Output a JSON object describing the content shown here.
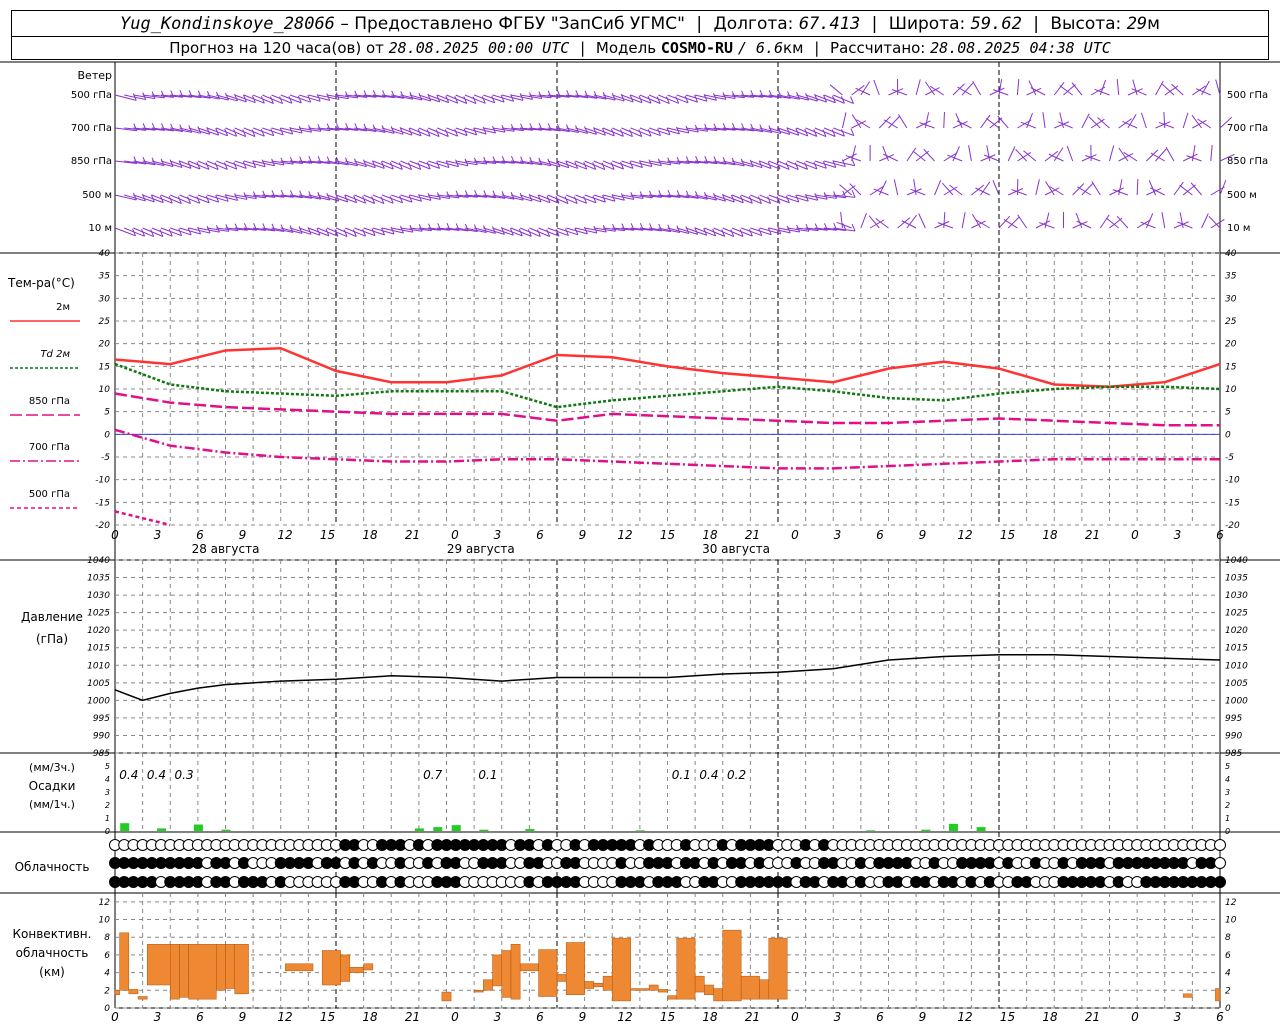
{
  "header": {
    "station": "Yug_Kondinskoye_28066",
    "provider": "– Предоставлено ФГБУ \"ЗапСиб УГМС\"",
    "lon_label": "Долгота:",
    "lon_value": "67.413",
    "lat_label": "Широта:",
    "lat_value": "59.62",
    "alt_label": "Высота:",
    "alt_value": "29",
    "alt_unit": "м",
    "forecast_label": "Прогноз на 120 часа(ов) от",
    "forecast_start": "28.08.2025 00:00 UTC",
    "model_label": "Модель",
    "model_name": "COSMO-RU",
    "model_res": "/ 6.6",
    "model_res_unit": "км",
    "calc_label": "Рассчитано:",
    "calc_time": "28.08.2025 04:38 UTC"
  },
  "chart_data": [
    {
      "type": "wind-barbs",
      "label": "Ветер",
      "levels": [
        "500 гПа",
        "700 гПа",
        "850 гПа",
        "500 м",
        "10 м"
      ]
    },
    {
      "type": "line",
      "title_line1": "Тем-ра(°C)",
      "legend": [
        {
          "name": "2м",
          "color": "#ff3333",
          "style": "solid"
        },
        {
          "name": "Td  2м",
          "color": "#117711",
          "style": "dotted"
        },
        {
          "name": "850 гПа",
          "color": "#e0108a",
          "style": "dash"
        },
        {
          "name": "700 гПа",
          "color": "#e0108a",
          "style": "dashdot"
        },
        {
          "name": "500 гПа",
          "color": "#e0108a",
          "style": "shortdash"
        }
      ],
      "ylim": [
        -20,
        40
      ],
      "yticks": [
        "40",
        "35",
        "30",
        "25",
        "20",
        "15",
        "10",
        "5",
        "0",
        "-5",
        "-10",
        "-15",
        "-20"
      ],
      "x_hours": [
        0,
        6,
        12,
        18,
        24,
        30,
        36,
        42,
        48,
        54,
        60,
        66,
        72,
        78,
        84,
        90,
        96,
        102,
        108,
        114,
        120
      ],
      "series": [
        {
          "name": "2м",
          "values": [
            16.5,
            15.5,
            18.5,
            19,
            14,
            11.5,
            11.5,
            13,
            17.5,
            17,
            15,
            13.5,
            12.5,
            11.5,
            14.5,
            16,
            14.5,
            11,
            10.5,
            11.5,
            15.5
          ]
        },
        {
          "name": "Td  2м",
          "values": [
            15.5,
            11,
            9.5,
            9,
            8.5,
            9.5,
            9.5,
            9.5,
            6,
            7.5,
            8.5,
            9.5,
            10.5,
            9.5,
            8,
            7.5,
            9,
            10,
            10.5,
            10.5,
            10
          ]
        },
        {
          "name": "850 гПа",
          "values": [
            9,
            7,
            6,
            5.5,
            5,
            4.5,
            4.5,
            4.5,
            3,
            4.5,
            4,
            3.5,
            3,
            2.5,
            2.5,
            3,
            3.5,
            3,
            2.5,
            2,
            2
          ]
        },
        {
          "name": "700 гПа",
          "values": [
            1,
            -2.5,
            -4,
            -5,
            -5.5,
            -6,
            -6,
            -5.5,
            -5.5,
            -6,
            -6.5,
            -7,
            -7.5,
            -7.5,
            -7,
            -6.5,
            -6,
            -5.5,
            -5.5,
            -5.5,
            -5.5
          ]
        },
        {
          "name": "500 гПа",
          "values": [
            -17,
            -20
          ]
        }
      ],
      "date_labels": [
        "28 августа",
        "29 августа",
        "30 августа"
      ],
      "tick_labels": [
        "0",
        "3",
        "6",
        "9",
        "12",
        "15",
        "18",
        "21",
        "0",
        "3",
        "6",
        "9",
        "12",
        "15",
        "18",
        "21",
        "0",
        "3",
        "6",
        "9",
        "12",
        "15",
        "18",
        "21",
        "0",
        "3",
        "6"
      ]
    },
    {
      "type": "line",
      "title_line1": "Давление",
      "title_line2": "(гПа)",
      "ylim": [
        985,
        1040
      ],
      "yticks": [
        "1040",
        "1035",
        "1030",
        "1025",
        "1020",
        "1015",
        "1010",
        "1005",
        "1000",
        "995",
        "990",
        "985"
      ],
      "x_hours": [
        0,
        3,
        6,
        9,
        12,
        18,
        24,
        30,
        36,
        42,
        48,
        54,
        60,
        66,
        72,
        78,
        84,
        90,
        96,
        102,
        108,
        114,
        120
      ],
      "values": [
        1003,
        1000,
        1002,
        1003.5,
        1004.5,
        1005.5,
        1006,
        1007,
        1006.5,
        1005.5,
        1006.5,
        1006.5,
        1006.5,
        1007.5,
        1008,
        1009,
        1011.5,
        1012.5,
        1013,
        1013,
        1012.5,
        1012,
        1011.5
      ]
    },
    {
      "type": "bar",
      "title_line1": "(мм/3ч.)",
      "title_line2": "Осадки",
      "title_line3": "(мм/1ч.)",
      "ylim": [
        0,
        5
      ],
      "yticks": [
        "5",
        "4",
        "3",
        "2",
        "1",
        "0"
      ],
      "color": "#22cc22",
      "x_hours": [
        1,
        5,
        9,
        12,
        33,
        35,
        37,
        40,
        45,
        57,
        82,
        88,
        91,
        94
      ],
      "values": [
        0.6,
        0.2,
        0.5,
        0.1,
        0.2,
        0.3,
        0.45,
        0.1,
        0.15,
        0.05,
        0.05,
        0.1,
        0.55,
        0.3
      ],
      "totals": [
        {
          "hour": 1.5,
          "text": "0.4"
        },
        {
          "hour": 4.5,
          "text": "0.4"
        },
        {
          "hour": 7.5,
          "text": "0.3"
        },
        {
          "hour": 34.5,
          "text": "0.7"
        },
        {
          "hour": 40.5,
          "text": "0.1"
        },
        {
          "hour": 61.5,
          "text": "0.1"
        },
        {
          "hour": 64.5,
          "text": "0.4"
        },
        {
          "hour": 67.5,
          "text": "0.2"
        }
      ]
    },
    {
      "type": "table",
      "label": "Облачность",
      "rows": 3
    },
    {
      "type": "bar",
      "title_line1": "Конвективн.",
      "title_line2": "облачность",
      "title_line3": "(км)",
      "ylim": [
        0,
        13
      ],
      "yticks": [
        "12",
        "10",
        "8",
        "6",
        "4",
        "2",
        "0"
      ],
      "color": "#ee8833",
      "blocks": [
        {
          "h0": 0,
          "h1": 0.5,
          "b": 1.5,
          "t": 2
        },
        {
          "h0": 0.5,
          "h1": 1.5,
          "b": 2,
          "t": 8.5
        },
        {
          "h0": 1.5,
          "h1": 2.5,
          "b": 1.6,
          "t": 2.1
        },
        {
          "h0": 2.5,
          "h1": 3.5,
          "b": 1,
          "t": 1.3
        },
        {
          "h0": 3.5,
          "h1": 6,
          "b": 2.6,
          "t": 7.2
        },
        {
          "h0": 6,
          "h1": 7,
          "b": 1,
          "t": 7.2
        },
        {
          "h0": 7,
          "h1": 8,
          "b": 1.2,
          "t": 7.2
        },
        {
          "h0": 8,
          "h1": 11,
          "b": 1,
          "t": 7.2
        },
        {
          "h0": 11,
          "h1": 12,
          "b": 2,
          "t": 7.2
        },
        {
          "h0": 12,
          "h1": 13,
          "b": 2.2,
          "t": 7.2
        },
        {
          "h0": 13,
          "h1": 14.5,
          "b": 1.6,
          "t": 7.2
        },
        {
          "h0": 18.5,
          "h1": 21.5,
          "b": 4.2,
          "t": 5
        },
        {
          "h0": 22.5,
          "h1": 24.5,
          "b": 2.6,
          "t": 6.5
        },
        {
          "h0": 24.5,
          "h1": 25.5,
          "b": 3,
          "t": 6
        },
        {
          "h0": 25.5,
          "h1": 27,
          "b": 4,
          "t": 4.6
        },
        {
          "h0": 27,
          "h1": 28,
          "b": 4.3,
          "t": 5
        },
        {
          "h0": 35.5,
          "h1": 36.5,
          "b": 0.8,
          "t": 1.8
        },
        {
          "h0": 39,
          "h1": 40,
          "b": 1.8,
          "t": 2
        },
        {
          "h0": 40,
          "h1": 41,
          "b": 2,
          "t": 3.2
        },
        {
          "h0": 41,
          "h1": 42,
          "b": 2.5,
          "t": 6
        },
        {
          "h0": 42,
          "h1": 43,
          "b": 1.2,
          "t": 6.5
        },
        {
          "h0": 43,
          "h1": 44,
          "b": 1,
          "t": 7.2
        },
        {
          "h0": 44,
          "h1": 46,
          "b": 4.2,
          "t": 5
        },
        {
          "h0": 46,
          "h1": 48,
          "b": 1.3,
          "t": 6.6
        },
        {
          "h0": 48,
          "h1": 49,
          "b": 3,
          "t": 3.8
        },
        {
          "h0": 49,
          "h1": 51,
          "b": 1.5,
          "t": 7.4
        },
        {
          "h0": 51,
          "h1": 52,
          "b": 2.2,
          "t": 3
        },
        {
          "h0": 52,
          "h1": 53,
          "b": 2.4,
          "t": 2.8
        },
        {
          "h0": 53,
          "h1": 54,
          "b": 2,
          "t": 3.6
        },
        {
          "h0": 54,
          "h1": 56,
          "b": 0.8,
          "t": 7.9
        },
        {
          "h0": 56,
          "h1": 58,
          "b": 2,
          "t": 2.2
        },
        {
          "h0": 58,
          "h1": 59,
          "b": 2,
          "t": 2.6
        },
        {
          "h0": 59,
          "h1": 60,
          "b": 1.8,
          "t": 2.1
        },
        {
          "h0": 60,
          "h1": 61,
          "b": 1,
          "t": 1.4
        },
        {
          "h0": 61,
          "h1": 63,
          "b": 1,
          "t": 7.9
        },
        {
          "h0": 63,
          "h1": 64,
          "b": 1.8,
          "t": 3.6
        },
        {
          "h0": 64,
          "h1": 65,
          "b": 1.5,
          "t": 2.6
        },
        {
          "h0": 65,
          "h1": 66,
          "b": 0.8,
          "t": 2.2
        },
        {
          "h0": 66,
          "h1": 68,
          "b": 0.8,
          "t": 8.8
        },
        {
          "h0": 68,
          "h1": 70,
          "b": 1,
          "t": 3.6
        },
        {
          "h0": 70,
          "h1": 71,
          "b": 1,
          "t": 3.2
        },
        {
          "h0": 71,
          "h1": 73,
          "b": 1,
          "t": 7.9
        },
        {
          "h0": 116,
          "h1": 117,
          "b": 1.2,
          "t": 1.6
        },
        {
          "h0": 119.5,
          "h1": 120,
          "b": 0.8,
          "t": 2.2
        }
      ]
    }
  ],
  "x_axis": {
    "bottom_ticks": [
      "0",
      "3",
      "6",
      "9",
      "12",
      "15",
      "18",
      "21",
      "0",
      "3",
      "6",
      "9",
      "12",
      "15",
      "18",
      "21",
      "0",
      "3",
      "6",
      "9",
      "12",
      "15",
      "18",
      "21",
      "0",
      "3",
      "6"
    ]
  },
  "colors": {
    "wind": "#8833cc",
    "grid": "#888888",
    "zero_line": "#3344cc"
  }
}
